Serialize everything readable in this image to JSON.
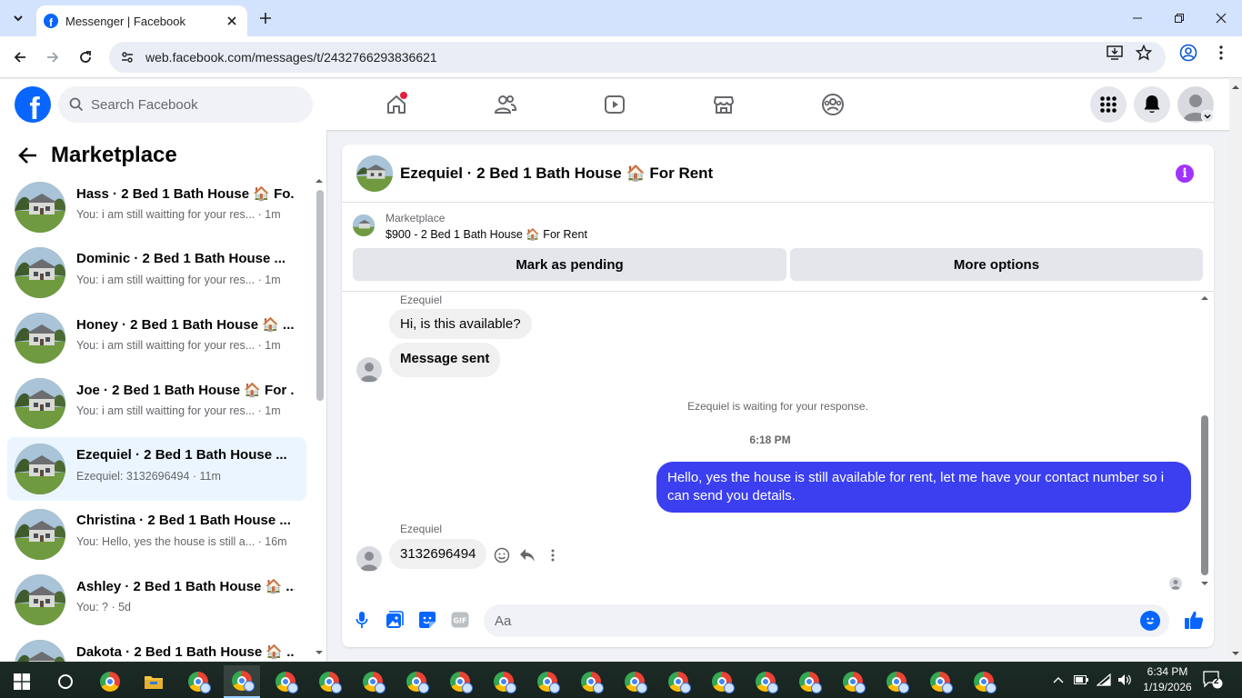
{
  "browser": {
    "tab_title": "Messenger | Facebook",
    "url": "web.facebook.com/messages/t/2432766293836621",
    "tab_favicon_letter": "f"
  },
  "facebook": {
    "logo_letter": "f",
    "search_placeholder": "Search Facebook",
    "nav_icons": [
      "home-icon",
      "friends-icon",
      "video-icon",
      "marketplace-icon",
      "groups-icon"
    ],
    "accent": "#0866ff"
  },
  "sidebar": {
    "title": "Marketplace",
    "conversations": [
      {
        "name": "Hass · 2 Bed 1 Bath House 🏠 Fo...",
        "preview": "You: i am still waitting for your res... · 1m"
      },
      {
        "name": "Dominic · 2 Bed 1 Bath House ...",
        "preview": "You: i am still waitting for your res... · 1m"
      },
      {
        "name": "Honey · 2 Bed 1 Bath House 🏠 ...",
        "preview": "You: i am still waitting for your res... · 1m"
      },
      {
        "name": "Joe · 2 Bed 1 Bath House 🏠 For ...",
        "preview": "You: i am still waitting for your res... · 1m"
      },
      {
        "name": "Ezequiel · 2 Bed 1 Bath House ...",
        "preview": "Ezequiel: 3132696494 · 11m",
        "active": true
      },
      {
        "name": "Christina · 2 Bed 1 Bath House ...",
        "preview": "You: Hello, yes the house is still a... · 16m"
      },
      {
        "name": "Ashley · 2 Bed 1 Bath House 🏠 ...",
        "preview": "You: ? · 5d"
      },
      {
        "name": "Dakota · 2 Bed 1 Bath House 🏠 ...",
        "preview": ""
      }
    ]
  },
  "chat": {
    "title": "Ezequiel · 2 Bed 1 Bath House 🏠 For Rent",
    "marketplace_label": "Marketplace",
    "listing": "$900 - 2 Bed 1 Bath House 🏠 For Rent",
    "btn_pending": "Mark as pending",
    "btn_more": "More options",
    "sender_name_1": "Ezequiel",
    "msg_1": "Hi, is this available?",
    "msg_2": "Message sent",
    "waiting_notice": "Ezequiel is waiting for your response.",
    "time_divider": "6:18 PM",
    "msg_out": "Hello, yes the house is still available for rent, let me have your contact number so i can send you  details.",
    "sender_name_2": "Ezequiel",
    "msg_3": "3132696494",
    "composer_placeholder": "Aa",
    "outgoing_color": "#3b3ff0"
  },
  "taskbar": {
    "time": "6:34 PM",
    "date": "1/19/2026",
    "notification_count": "2"
  }
}
